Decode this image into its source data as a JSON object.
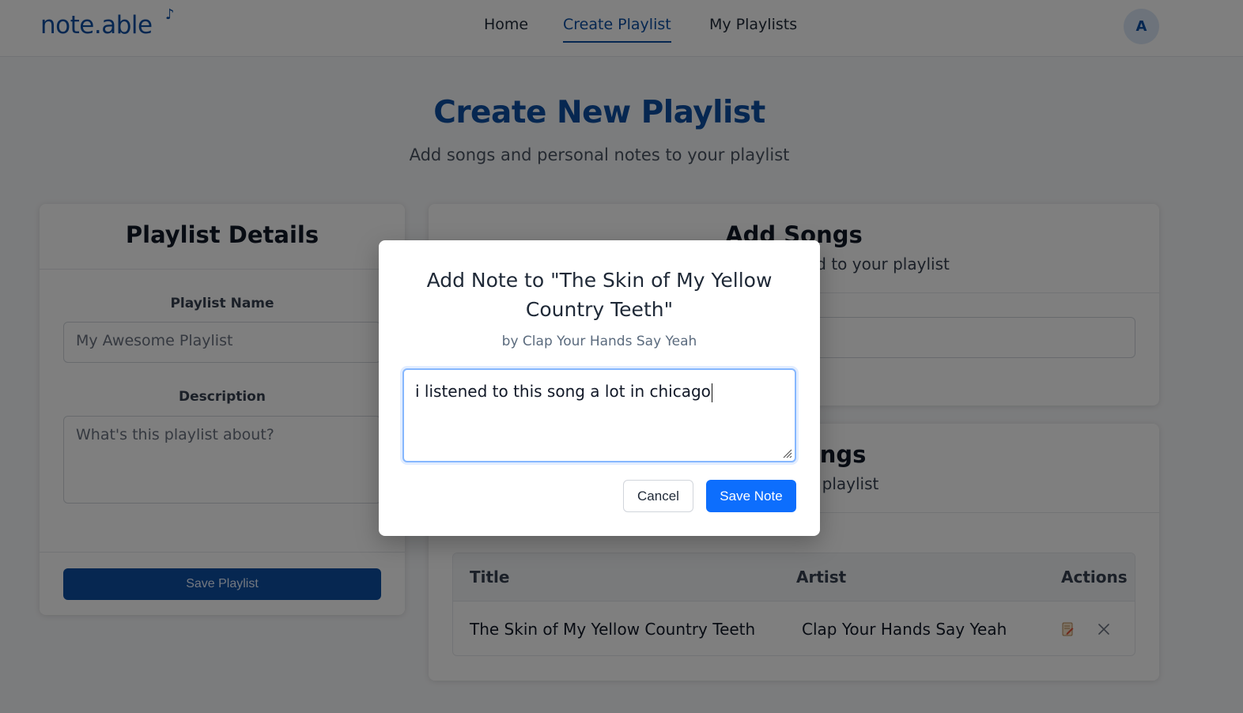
{
  "brand": {
    "name": "note.able",
    "mark": "♪"
  },
  "nav": {
    "home": "Home",
    "create": "Create Playlist",
    "mine": "My Playlists"
  },
  "user": {
    "initial": "A"
  },
  "hero": {
    "title": "Create New Playlist",
    "subtitle": "Add songs and personal notes to your playlist"
  },
  "details": {
    "title": "Playlist Details",
    "name_label": "Playlist Name",
    "name_placeholder": "My Awesome Playlist",
    "description_label": "Description",
    "description_placeholder": "What's this playlist about?",
    "save_label": "Save Playlist"
  },
  "add_songs": {
    "title": "Add Songs",
    "subtitle": "Search for songs to add to your playlist"
  },
  "songs_table": {
    "title": "Your Songs",
    "subtitle": "Songs in your playlist",
    "headers": {
      "title": "Title",
      "artist": "Artist",
      "actions": "Actions"
    },
    "rows": [
      {
        "title": "The Skin of My Yellow Country Teeth",
        "artist": "Clap Your Hands Say Yeah"
      }
    ]
  },
  "modal": {
    "title": "Add Note to \"The Skin of My Yellow Country Teeth\"",
    "subtitle": "by Clap Your Hands Say Yeah",
    "note_value": "i listened to this song a lot in chicago",
    "cancel_label": "Cancel",
    "save_label": "Save Note"
  },
  "colors": {
    "brand": "#0d4fa3",
    "primary_button": "#0d6efd",
    "overlay": "rgba(0,0,0,0.5)"
  }
}
